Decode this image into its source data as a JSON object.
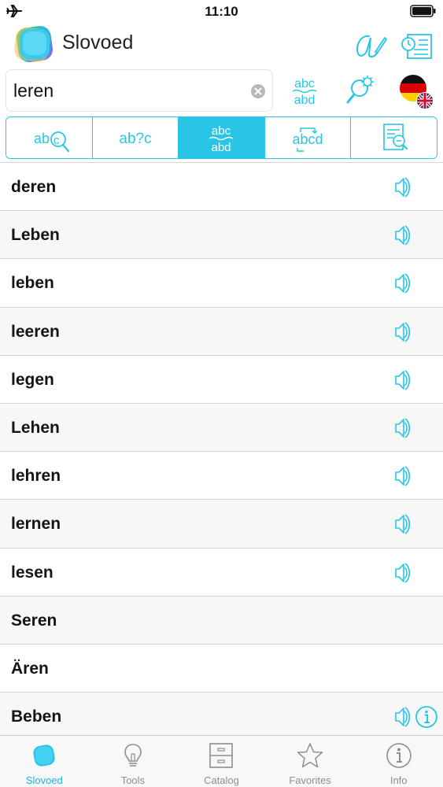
{
  "status_bar": {
    "time": "11:10",
    "airplane_icon": "airplane-icon",
    "battery_icon": "battery-icon"
  },
  "header": {
    "app_title": "Slovoed",
    "logo_icon": "slovoed-logo-icon",
    "buttons": [
      "handwriting-icon",
      "history-icon"
    ]
  },
  "search": {
    "value": "leren",
    "placeholder": "",
    "clear_icon": "clear-icon",
    "buttons": [
      "fuzzy-search-icon",
      "settings-search-icon",
      "language-flag-icon"
    ],
    "language_pair": [
      "German",
      "English"
    ]
  },
  "modes": [
    {
      "id": "wildcard",
      "label": "abc search",
      "active": false
    },
    {
      "id": "pattern",
      "label": "ab?c",
      "active": false
    },
    {
      "id": "fuzzy",
      "label": "abc abd",
      "active": true
    },
    {
      "id": "anagram",
      "label": "abcd",
      "active": false
    },
    {
      "id": "fulltext",
      "label": "full text",
      "active": false
    }
  ],
  "words": [
    {
      "text": "deren",
      "sound": true,
      "info": false
    },
    {
      "text": "Leben",
      "sound": true,
      "info": false
    },
    {
      "text": "leben",
      "sound": true,
      "info": false
    },
    {
      "text": "leeren",
      "sound": true,
      "info": false
    },
    {
      "text": "legen",
      "sound": true,
      "info": false
    },
    {
      "text": "Lehen",
      "sound": true,
      "info": false
    },
    {
      "text": "lehren",
      "sound": true,
      "info": false
    },
    {
      "text": "lernen",
      "sound": true,
      "info": false
    },
    {
      "text": "lesen",
      "sound": true,
      "info": false
    },
    {
      "text": "Seren",
      "sound": false,
      "info": false
    },
    {
      "text": "Ären",
      "sound": false,
      "info": false
    },
    {
      "text": "Beben",
      "sound": true,
      "info": true
    }
  ],
  "tabs": [
    {
      "label": "Slovoed",
      "icon": "slovoed-tab-icon",
      "active": true
    },
    {
      "label": "Tools",
      "icon": "lightbulb-icon",
      "active": false
    },
    {
      "label": "Catalog",
      "icon": "catalog-icon",
      "active": false
    },
    {
      "label": "Favorites",
      "icon": "star-icon",
      "active": false
    },
    {
      "label": "Info",
      "icon": "info-icon",
      "active": false
    }
  ],
  "colors": {
    "accent": "#29c5e6",
    "tab_active": "#1ab7e3",
    "tab_inactive": "#8e8e8e"
  }
}
